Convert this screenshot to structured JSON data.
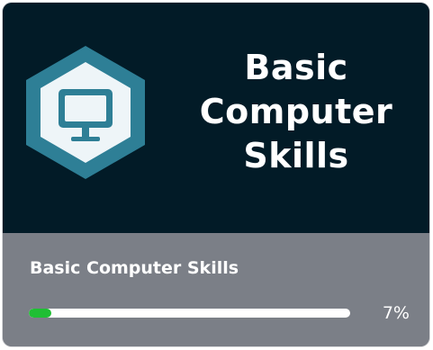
{
  "card": {
    "banner": {
      "title_lines": [
        "Basic",
        "Computer",
        "Skills"
      ],
      "badge_icon": "computer-monitor-icon",
      "colors": {
        "background": "#021b27",
        "badge_frame": "#2e7f96",
        "badge_inner": "#eef5f8",
        "icon": "#2e7f96"
      }
    },
    "footer": {
      "course_name": "Basic Computer Skills",
      "progress_text": "7%",
      "progress_fraction": 0.07,
      "colors": {
        "background": "#7b7f87",
        "track": "#ffffff",
        "fill": "#1fbf34"
      }
    }
  }
}
